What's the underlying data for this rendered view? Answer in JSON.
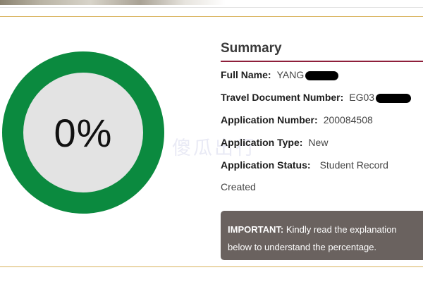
{
  "progress": {
    "label": "0%",
    "value": 0,
    "ring_color": "#0b8a3f",
    "track_color": "#e3e3e3"
  },
  "watermark": "傻瓜出行",
  "summary": {
    "title": "Summary",
    "fields": [
      {
        "label": "Full Name",
        "value": "YANG"
      },
      {
        "label": "Travel Document Number",
        "value": "EG03"
      },
      {
        "label": "Application Number",
        "value": "200084508"
      },
      {
        "label": "Application Type",
        "value": "New"
      },
      {
        "label": "Application Status",
        "value": "Student Record",
        "value_cont": "Created"
      }
    ]
  },
  "notice": {
    "strong": "IMPORTANT:",
    "text": "Kindly read the explanation below to understand the percentage."
  },
  "colors": {
    "accent_line": "#8e1f3a",
    "gold_line": "#d8b25a",
    "notice_bg": "#6a625f"
  }
}
